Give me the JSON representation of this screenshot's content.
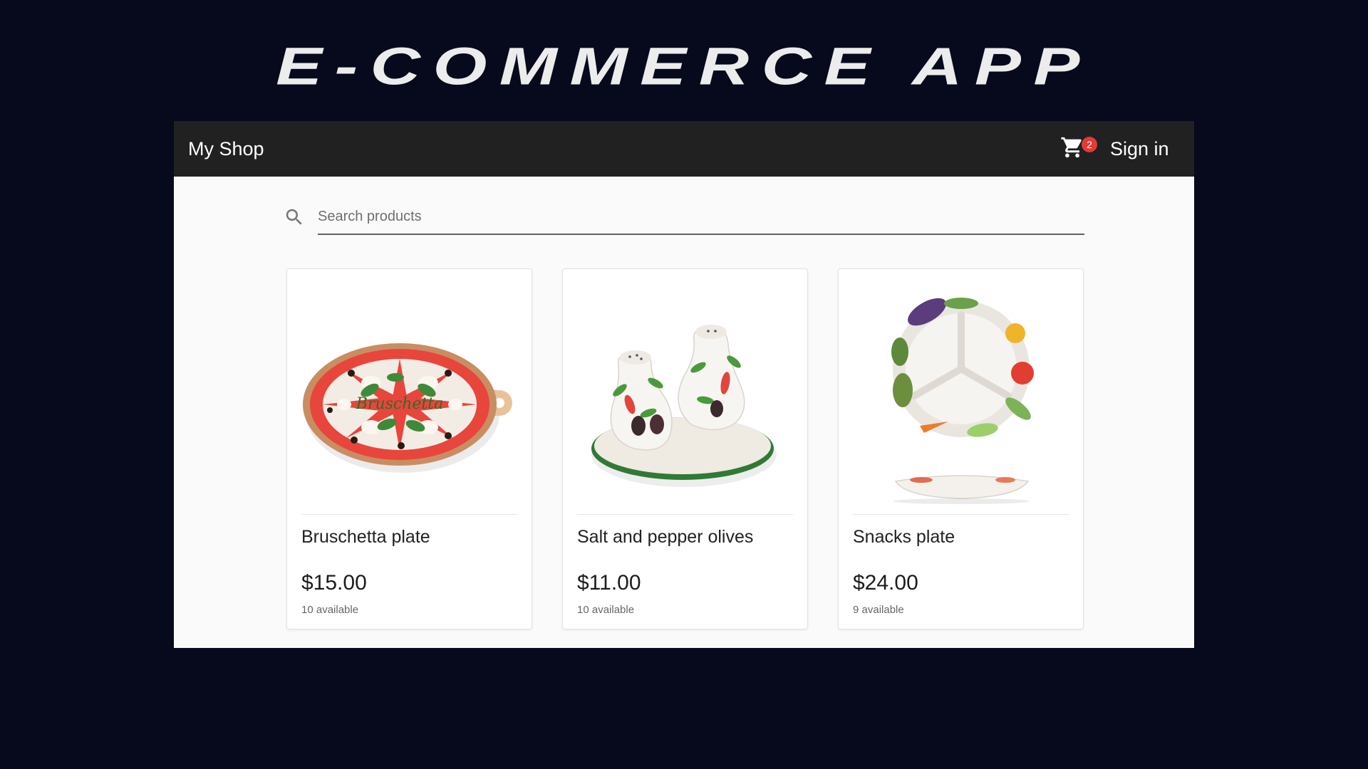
{
  "banner": {
    "title": "E-COMMERCE APP"
  },
  "toolbar": {
    "title": "My Shop",
    "cart_count": "2",
    "signin_label": "Sign in"
  },
  "search": {
    "placeholder": "Search products",
    "value": ""
  },
  "products": [
    {
      "name": "Bruschetta plate",
      "price": "$15.00",
      "stock": "10 available",
      "image_lettering": "Bruschetta"
    },
    {
      "name": "Salt and pepper olives",
      "price": "$11.00",
      "stock": "10 available"
    },
    {
      "name": "Snacks plate",
      "price": "$24.00",
      "stock": "9 available"
    }
  ],
  "colors": {
    "page_background": "#060a1c",
    "toolbar": "#212121",
    "content_background": "#fafafa",
    "badge": "#e53935"
  }
}
